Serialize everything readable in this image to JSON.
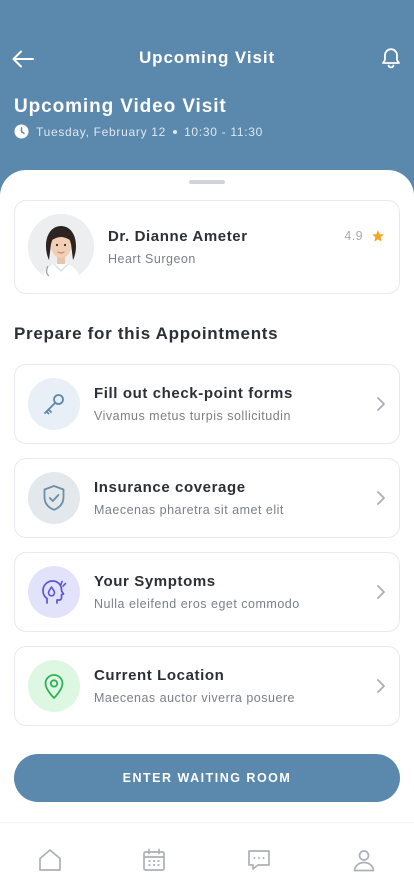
{
  "header": {
    "title": "Upcoming Visit",
    "visit_title": "Upcoming Video Visit",
    "visit_date": "Tuesday, February 12",
    "visit_time": "10:30 - 11:30"
  },
  "doctor": {
    "name": "Dr. Dianne Ameter",
    "specialty": "Heart Surgeon",
    "rating": "4.9"
  },
  "section": {
    "title": "Prepare for this Appointments"
  },
  "tasks": [
    {
      "title": "Fill out check-point forms",
      "subtitle": "Vivamus metus turpis sollicitudin",
      "icon": "key-icon",
      "color": "#e8eff6"
    },
    {
      "title": "Insurance coverage",
      "subtitle": "Maecenas pharetra sit amet elit",
      "icon": "shield-check-icon",
      "color": "#e3e8ec"
    },
    {
      "title": "Your Symptoms",
      "subtitle": "Nulla eleifend eros eget commodo",
      "icon": "head-symptom-icon",
      "color": "#e2e3fb"
    },
    {
      "title": "Current Location",
      "subtitle": "Maecenas auctor viverra posuere",
      "icon": "location-pin-icon",
      "color": "#ddf7e3"
    }
  ],
  "cta": {
    "label": "ENTER WAITING ROOM"
  },
  "tabbar": {
    "items": [
      "home-icon",
      "calendar-icon",
      "chat-icon",
      "profile-icon"
    ]
  },
  "colors": {
    "primary": "#5b89ad",
    "star": "#f5a623"
  }
}
